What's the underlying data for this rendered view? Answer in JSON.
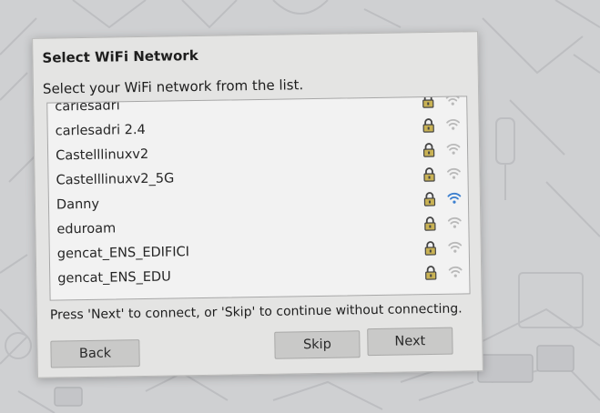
{
  "dialog": {
    "title": "Select WiFi Network",
    "instruction": "Select your WiFi network from the list.",
    "footer": "Press 'Next' to connect, or 'Skip' to continue without connecting."
  },
  "networks": [
    {
      "ssid": "carlesadri",
      "secured": true,
      "signal_icon": "wifi-weak-icon"
    },
    {
      "ssid": "carlesadri 2.4",
      "secured": true,
      "signal_icon": "wifi-weak-icon"
    },
    {
      "ssid": "Castelllinuxv2",
      "secured": true,
      "signal_icon": "wifi-weak-icon"
    },
    {
      "ssid": "Castelllinuxv2_5G",
      "secured": true,
      "signal_icon": "wifi-weak-icon"
    },
    {
      "ssid": "Danny",
      "secured": true,
      "signal_icon": "wifi-strong-icon"
    },
    {
      "ssid": "eduroam",
      "secured": true,
      "signal_icon": "wifi-weak-icon"
    },
    {
      "ssid": "gencat_ENS_EDIFICI",
      "secured": true,
      "signal_icon": "wifi-weak-icon"
    },
    {
      "ssid": "gencat_ENS_EDU",
      "secured": true,
      "signal_icon": "wifi-weak-icon"
    }
  ],
  "buttons": {
    "back": "Back",
    "skip": "Skip",
    "next": "Next"
  },
  "colors": {
    "dialog_bg": "#e4e4e3",
    "list_bg": "#f2f2f2",
    "button_bg": "#c9c9c8",
    "lock_color": "#c9b254",
    "wifi_strong": "#3b7fcf",
    "wifi_weak": "#b9b9b9"
  }
}
